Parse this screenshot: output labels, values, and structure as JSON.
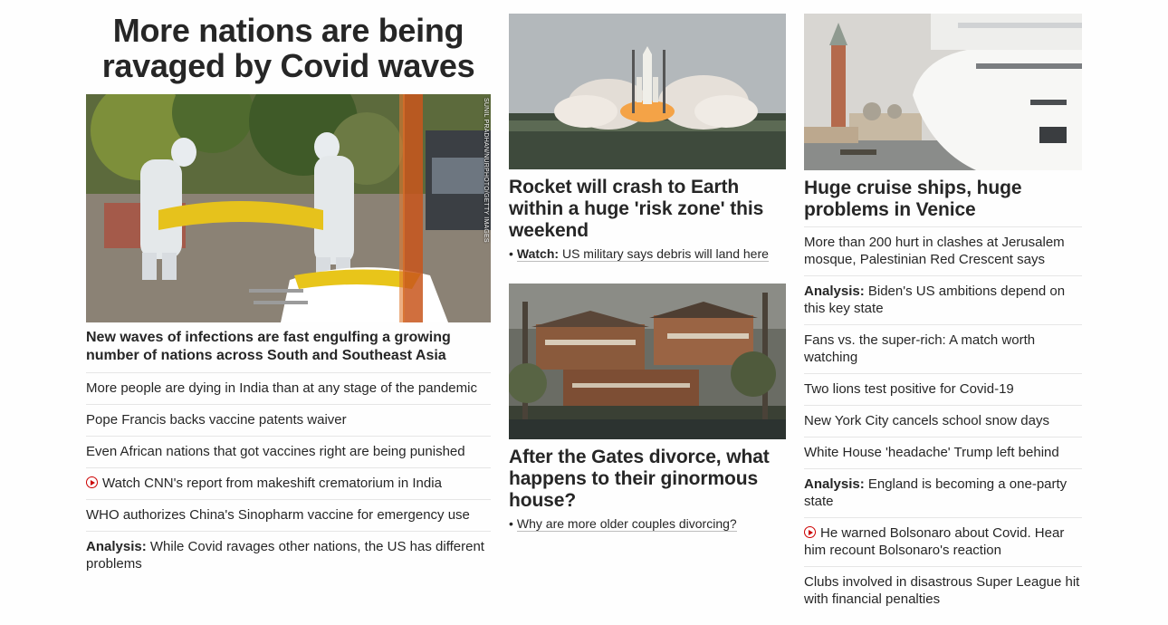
{
  "left": {
    "title": "More nations are being ravaged by Covid waves",
    "image_credit": "SUNIL PRADHAN/NURPHOTO/GETTY IMAGES",
    "lead": "New waves of infections are fast engulfing a growing number of nations across South and Southeast Asia",
    "items": [
      {
        "text": "More people are dying in India than at any stage of the pandemic"
      },
      {
        "text": "Pope Francis backs vaccine patents waiver"
      },
      {
        "text": "Even African nations that got vaccines right are being punished"
      },
      {
        "text": "Watch CNN's report from makeshift crematorium in India",
        "icon": "play-icon"
      },
      {
        "text": "WHO authorizes China's Sinopharm vaccine for emergency use"
      },
      {
        "prefix": "Analysis:",
        "text": " While Covid ravages other nations, the US has different problems"
      }
    ]
  },
  "middle": {
    "story1": {
      "headline": "Rocket will crash to Earth within a huge 'risk zone' this weekend",
      "sub_prefix": "Watch:",
      "sub_text": "US military says debris will land here"
    },
    "story2": {
      "headline": "After the Gates divorce, what happens to their ginormous house?",
      "sub_text": "Why are more older couples divorcing?"
    },
    "bullet": "•"
  },
  "right": {
    "headline": "Huge cruise ships, huge problems in Venice",
    "items": [
      {
        "text": "More than 200 hurt in clashes at Jerusalem mosque, Palestinian Red Crescent says"
      },
      {
        "prefix": "Analysis:",
        "text": " Biden's US ambitions depend on this key state"
      },
      {
        "text": "Fans vs. the super-rich: A match worth watching"
      },
      {
        "text": "Two lions test positive for Covid-19"
      },
      {
        "text": "New York City cancels school snow days"
      },
      {
        "text": "White House 'headache' Trump left behind"
      },
      {
        "prefix": "Analysis:",
        "text": " England is becoming a one-party state"
      },
      {
        "text": "He warned Bolsonaro about Covid. Hear him recount Bolsonaro's reaction",
        "icon": "play-icon"
      },
      {
        "text": "Clubs involved in disastrous Super League hit with financial penalties"
      }
    ]
  },
  "colors": {
    "text": "#262626",
    "video_icon": "#cc0000",
    "divider": "#e6e6e6"
  }
}
